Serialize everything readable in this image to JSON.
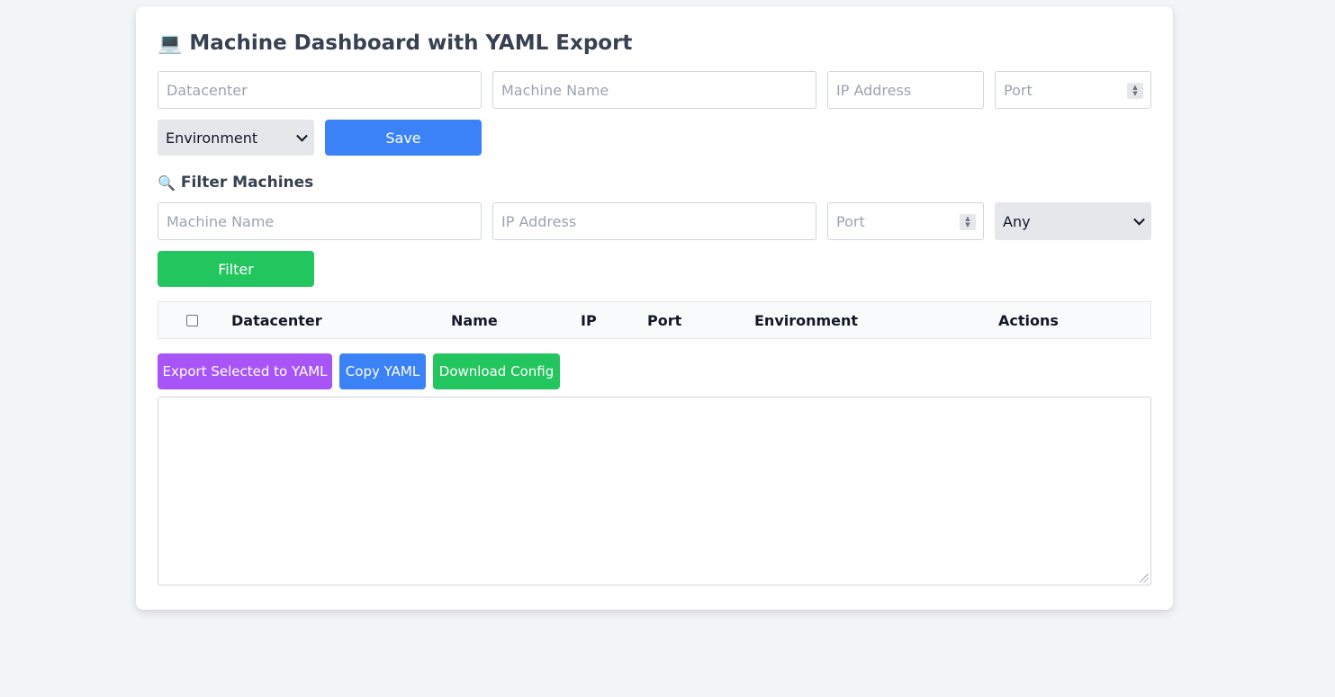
{
  "header": {
    "title": "Machine Dashboard with YAML Export",
    "title_emoji": "💻"
  },
  "form": {
    "datacenter_placeholder": "Datacenter",
    "machine_name_placeholder": "Machine Name",
    "ip_placeholder": "IP Address",
    "port_placeholder": "Port",
    "environment_selected": "Environment",
    "save_label": "Save"
  },
  "filter": {
    "heading": "Filter Machines",
    "heading_emoji": "🔍",
    "machine_name_placeholder": "Machine Name",
    "ip_placeholder": "IP Address",
    "port_placeholder": "Port",
    "environment_selected": "Any",
    "button_label": "Filter"
  },
  "table": {
    "columns": [
      "Datacenter",
      "Name",
      "IP",
      "Port",
      "Environment",
      "Actions"
    ],
    "rows": []
  },
  "actions": {
    "export_label": "Export Selected to YAML",
    "copy_label": "Copy YAML",
    "download_label": "Download Config"
  },
  "yaml_output": {
    "value": ""
  },
  "colors": {
    "primary_blue": "#3b82f6",
    "green": "#22c55e",
    "purple": "#a855f7",
    "background": "#f3f4f6"
  }
}
